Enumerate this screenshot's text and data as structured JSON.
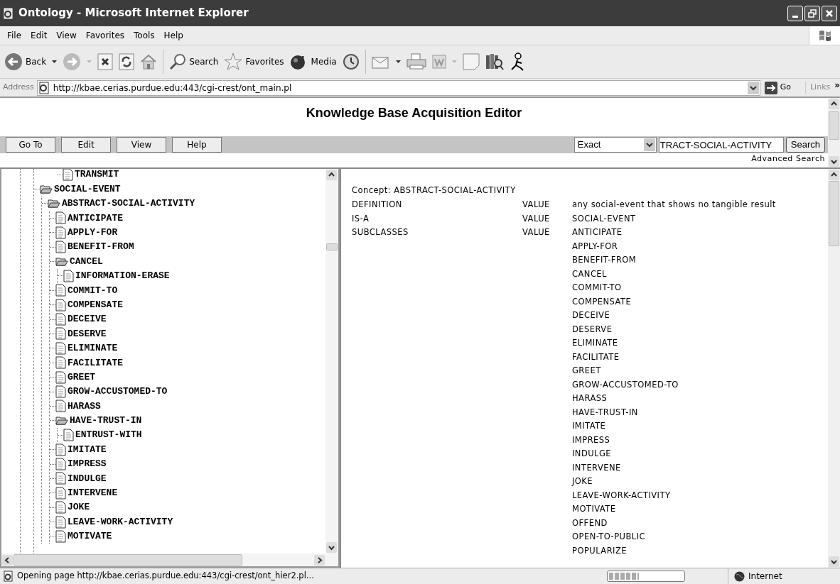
{
  "window": {
    "title": "Ontology - Microsoft Internet Explorer"
  },
  "menu_bar": [
    "File",
    "Edit",
    "View",
    "Favorites",
    "Tools",
    "Help"
  ],
  "toolbar": {
    "back": "Back",
    "search": "Search",
    "favorites": "Favorites",
    "media": "Media"
  },
  "address_bar": {
    "label": "Address",
    "url": "http://kbae.cerias.purdue.edu:443/cgi-crest/ont_main.pl",
    "go": "Go",
    "links": "Links",
    "more": "»"
  },
  "page": {
    "heading": "Knowledge Base Acquisition Editor",
    "nav_buttons": [
      "Go To",
      "Edit",
      "View",
      "Help"
    ],
    "match_mode": "Exact",
    "search_value": "TRACT-SOCIAL-ACTIVITY",
    "search_button": "Search",
    "advanced_search": "Advanced Search"
  },
  "tree": {
    "top_item": {
      "label": "TRANSMIT",
      "kind": "document"
    },
    "items": [
      {
        "label": "SOCIAL-EVENT",
        "kind": "folder",
        "children": [
          {
            "label": "ABSTRACT-SOCIAL-ACTIVITY",
            "kind": "folder",
            "children": [
              {
                "label": "ANTICIPATE",
                "kind": "document"
              },
              {
                "label": "APPLY-FOR",
                "kind": "document"
              },
              {
                "label": "BENEFIT-FROM",
                "kind": "document"
              },
              {
                "label": "CANCEL",
                "kind": "folder",
                "children": [
                  {
                    "label": "INFORMATION-ERASE",
                    "kind": "document"
                  }
                ]
              },
              {
                "label": "COMMIT-TO",
                "kind": "document"
              },
              {
                "label": "COMPENSATE",
                "kind": "document"
              },
              {
                "label": "DECEIVE",
                "kind": "document"
              },
              {
                "label": "DESERVE",
                "kind": "document"
              },
              {
                "label": "ELIMINATE",
                "kind": "document"
              },
              {
                "label": "FACILITATE",
                "kind": "document"
              },
              {
                "label": "GREET",
                "kind": "document"
              },
              {
                "label": "GROW-ACCUSTOMED-TO",
                "kind": "document"
              },
              {
                "label": "HARASS",
                "kind": "document"
              },
              {
                "label": "HAVE-TRUST-IN",
                "kind": "folder",
                "children": [
                  {
                    "label": "ENTRUST-WITH",
                    "kind": "document"
                  }
                ]
              },
              {
                "label": "IMITATE",
                "kind": "document"
              },
              {
                "label": "IMPRESS",
                "kind": "document"
              },
              {
                "label": "INDULGE",
                "kind": "document"
              },
              {
                "label": "INTERVENE",
                "kind": "document"
              },
              {
                "label": "JOKE",
                "kind": "document"
              },
              {
                "label": "LEAVE-WORK-ACTIVITY",
                "kind": "document"
              },
              {
                "label": "MOTIVATE",
                "kind": "document"
              }
            ]
          }
        ]
      }
    ]
  },
  "concept": {
    "title": "Concept: ABSTRACT-SOCIAL-ACTIVITY",
    "rows": [
      {
        "slot": "DEFINITION",
        "facet": "VALUE",
        "values": [
          "any social-event that shows no tangible result"
        ]
      },
      {
        "slot": "IS-A",
        "facet": "VALUE",
        "values": [
          "SOCIAL-EVENT"
        ]
      },
      {
        "slot": "SUBCLASSES",
        "facet": "VALUE",
        "values": [
          "ANTICIPATE",
          "APPLY-FOR",
          "BENEFIT-FROM",
          "CANCEL",
          "COMMIT-TO",
          "COMPENSATE",
          "DECEIVE",
          "DESERVE",
          "ELIMINATE",
          "FACILITATE",
          "GREET",
          "GROW-ACCUSTOMED-TO",
          "HARASS",
          "HAVE-TRUST-IN",
          "IMITATE",
          "IMPRESS",
          "INDULGE",
          "INTERVENE",
          "JOKE",
          "LEAVE-WORK-ACTIVITY",
          "MOTIVATE",
          "OFFEND",
          "OPEN-TO-PUBLIC",
          "POPULARIZE"
        ]
      }
    ]
  },
  "status_bar": {
    "message": "Opening page http://kbae.cerias.purdue.edu:443/cgi-crest/ont_hier2.pl...",
    "progress": {
      "level": 0.4
    },
    "zone": "Internet"
  }
}
